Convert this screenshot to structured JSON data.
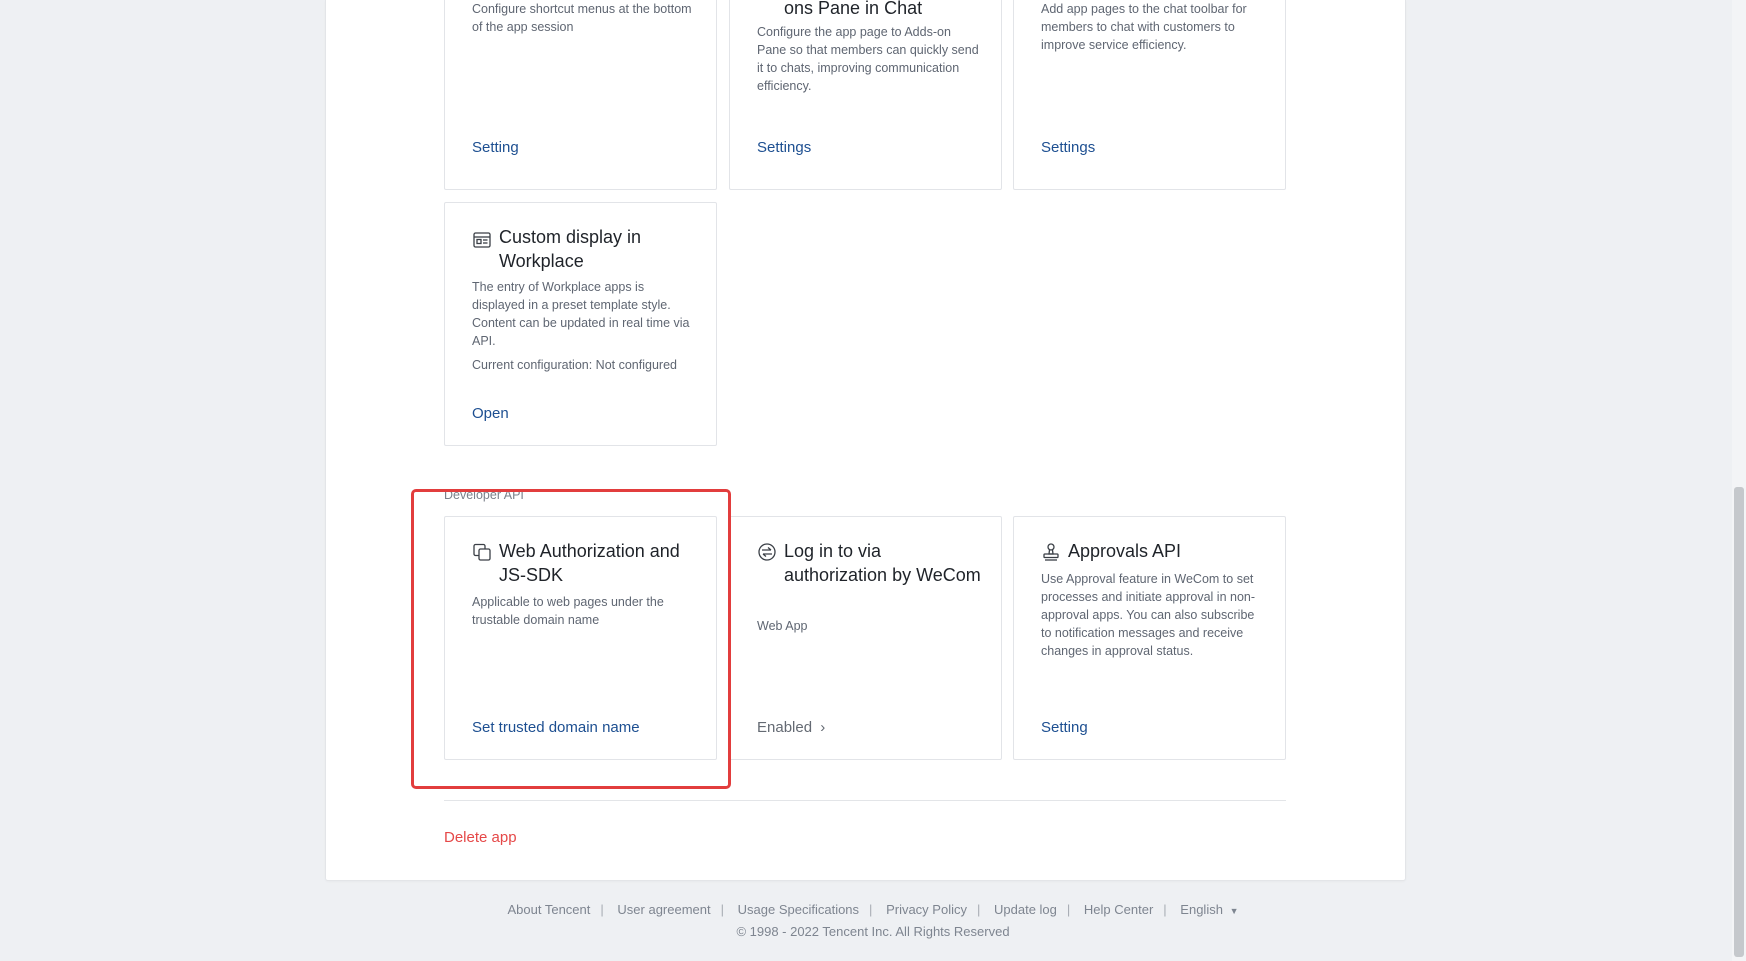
{
  "cards": {
    "shortcut_menu": {
      "desc": "Configure shortcut menus at the bottom of the app session",
      "action": "Setting"
    },
    "adds_on_pane": {
      "title": "ons Pane in Chat",
      "desc": "Configure the app page to Adds-on Pane so that members can quickly send it to chats, improving communication efficiency.",
      "action": "Settings"
    },
    "chat_toolbar": {
      "desc": "Add app pages to the chat toolbar for members to chat with customers to improve service efficiency.",
      "action": "Settings"
    },
    "custom_display": {
      "title": "Custom display in Workplace",
      "desc": "The entry of Workplace apps is displayed in a preset template style. Content can be updated in real time via API.",
      "config": "Current configuration: Not configured",
      "action": "Open"
    },
    "web_auth": {
      "title": "Web Authorization and JS-SDK",
      "desc": "Applicable to web pages under the trustable domain name",
      "action": "Set trusted domain name"
    },
    "login_wecom": {
      "title": "Log in to via authorization by WeCom",
      "desc": "Web App",
      "action": "Enabled",
      "action_chevron": "›"
    },
    "approvals_api": {
      "title": "Approvals API",
      "desc": "Use Approval feature in WeCom to set processes and initiate approval in non-approval apps. You can also subscribe to notification messages and receive changes in approval status.",
      "action": "Setting"
    }
  },
  "section_developer_api": "Developer API",
  "delete_app": "Delete app",
  "footer": {
    "links": [
      "About Tencent",
      "User agreement",
      "Usage Specifications",
      "Privacy Policy",
      "Update log",
      "Help Center"
    ],
    "language": "English",
    "language_caret": "▼",
    "copyright": "© 1998 - 2022 Tencent Inc. All Rights Reserved"
  },
  "icons": {
    "custom_display": "layout-icon",
    "web_auth": "copy-window-icon",
    "login_wecom": "login-circle-icon",
    "approvals_api": "stamp-icon"
  },
  "colors": {
    "link": "#1d4f91",
    "danger": "#e54848",
    "highlight": "#e23d3d"
  }
}
